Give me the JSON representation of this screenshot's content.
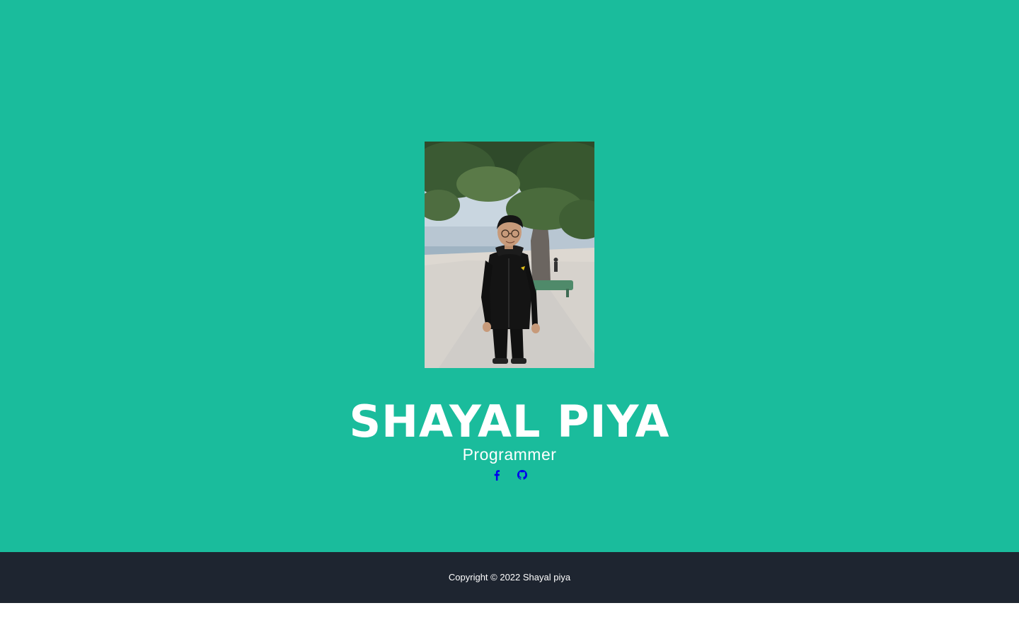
{
  "hero": {
    "name": "SHAYAL PIYA",
    "role": "Programmer",
    "bg_color": "#1abc9c"
  },
  "social": [
    {
      "icon": "facebook-icon",
      "color": "#0000ee"
    },
    {
      "icon": "github-icon",
      "color": "#0000ee"
    }
  ],
  "footer": {
    "text": "Copyright © 2022 Shayal piya",
    "bg_color": "#1e2530"
  }
}
